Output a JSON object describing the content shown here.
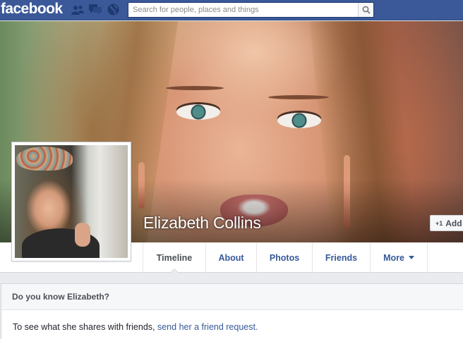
{
  "header": {
    "logo": "facebook",
    "search_placeholder": "Search for people, places and things",
    "icons": [
      "friend-requests-icon",
      "messages-icon",
      "notifications-globe-icon",
      "search-icon"
    ],
    "brand_color": "#3b5998"
  },
  "profile": {
    "name": "Elizabeth Collins",
    "add_friend_label": "Add"
  },
  "nav": {
    "tabs": [
      {
        "label": "Timeline",
        "active": true
      },
      {
        "label": "About"
      },
      {
        "label": "Photos"
      },
      {
        "label": "Friends"
      },
      {
        "label": "More"
      }
    ]
  },
  "know_box": {
    "title": "Do you know Elizabeth?",
    "text": "To see what she shares with friends,",
    "link": "send her a friend request."
  }
}
